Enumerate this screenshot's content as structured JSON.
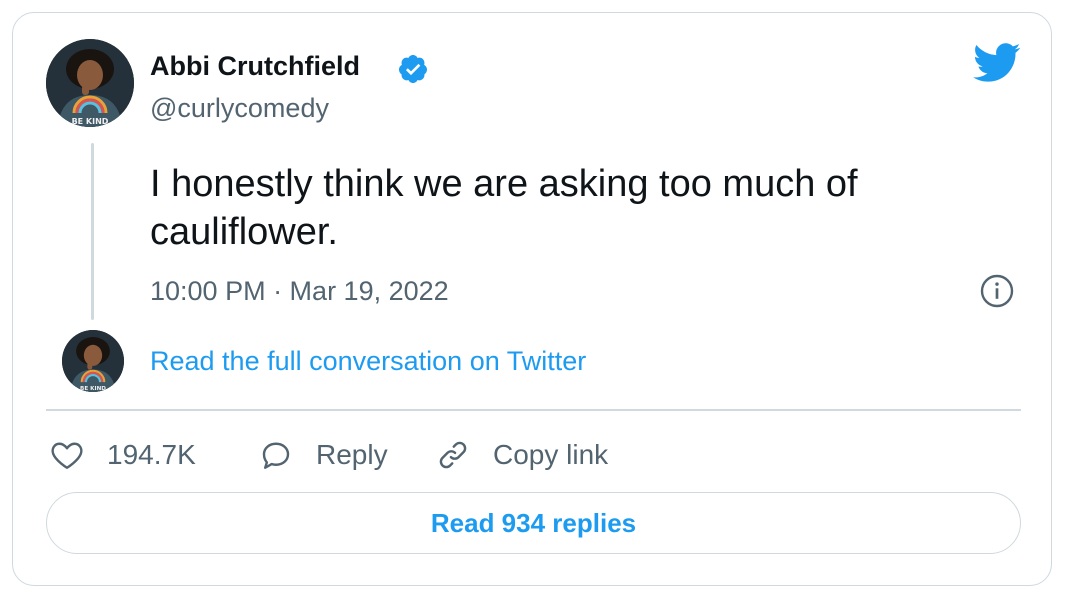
{
  "tweet": {
    "author": {
      "display_name": "Abbi Crutchfield",
      "handle": "@curlycomedy",
      "verified": true,
      "avatar_icon": "avatar-portrait-icon",
      "shirt_text": "BE KIND"
    },
    "text": "I honestly think we are asking too much of cauliflower.",
    "timestamp": "10:00 PM · Mar 19, 2022",
    "read_conversation_label": "Read the full conversation on Twitter",
    "actions": {
      "likes_count": "194.7K",
      "reply_label": "Reply",
      "copy_link_label": "Copy link"
    },
    "read_replies_label": "Read 934 replies"
  },
  "icons": {
    "brand": "twitter-bird-icon",
    "verified": "verified-badge-icon",
    "info": "info-icon",
    "like": "heart-icon",
    "reply": "speech-bubble-icon",
    "copy": "link-icon"
  },
  "colors": {
    "accent": "#1d9bf0",
    "text_primary": "#0f1419",
    "text_secondary": "#536471",
    "border": "#cfd9de"
  }
}
